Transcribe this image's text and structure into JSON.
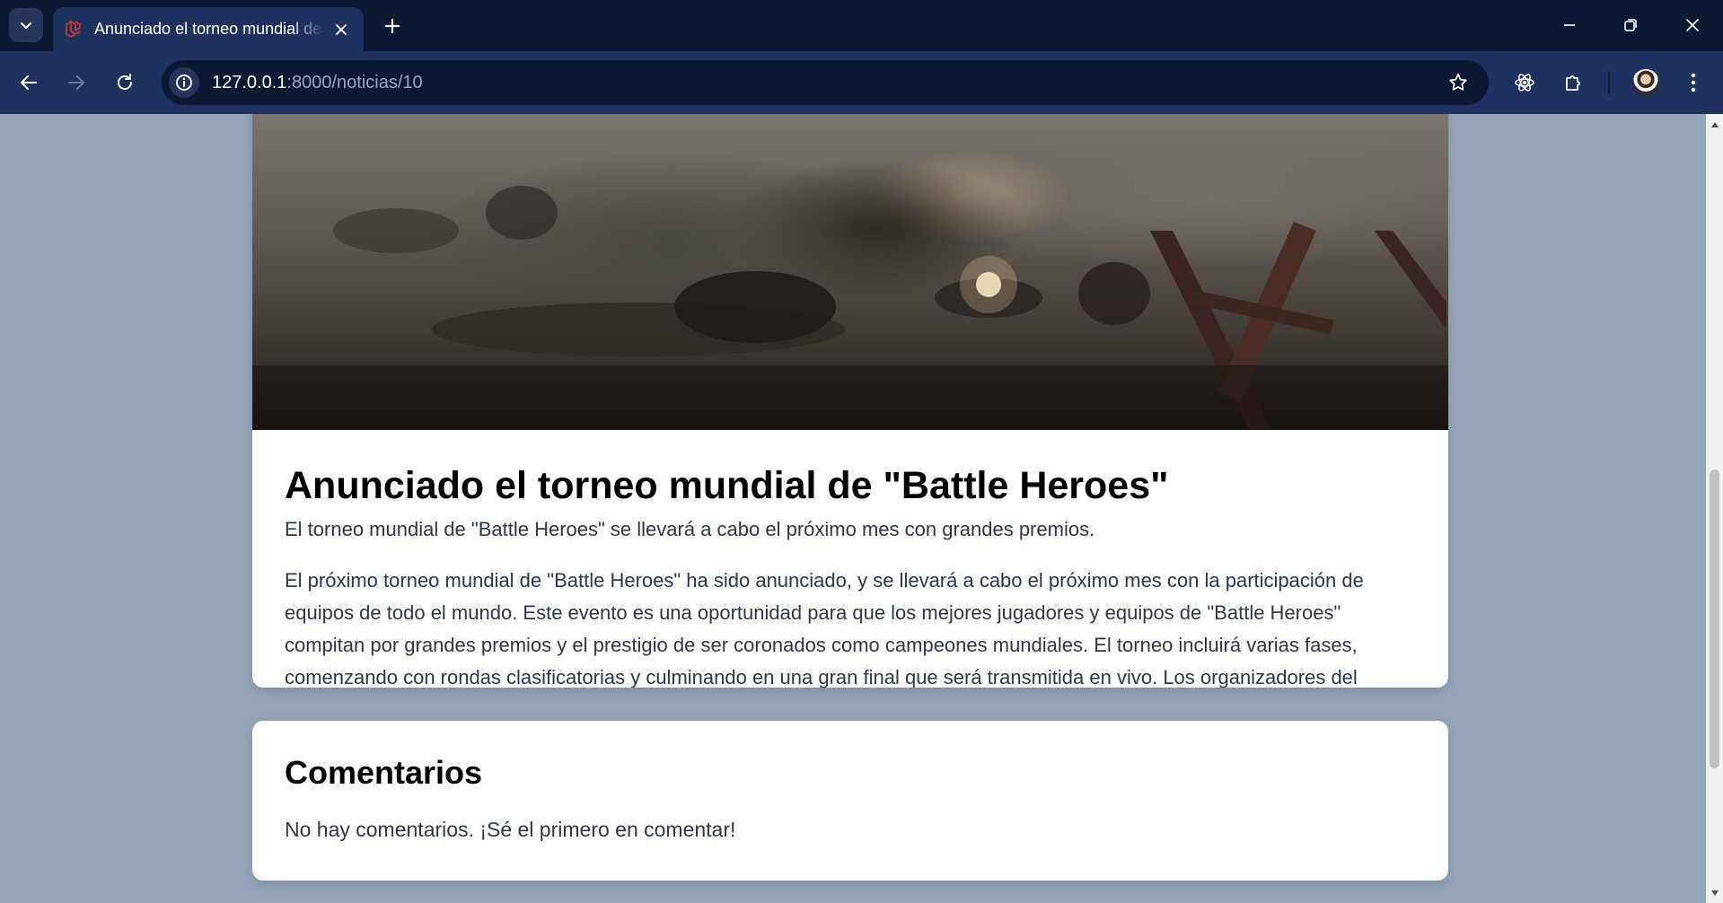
{
  "browser": {
    "tab": {
      "title": "Anunciado el torneo mundial de \"Battle Heroes\""
    },
    "url": {
      "host": "127.0.0.1",
      "path": ":8000/noticias/10"
    }
  },
  "article": {
    "title": "Anunciado el torneo mundial de \"Battle Heroes\"",
    "summary": "El torneo mundial de \"Battle Heroes\" se llevará a cabo el próximo mes con grandes premios.",
    "content": "El próximo torneo mundial de \"Battle Heroes\" ha sido anunciado, y se llevará a cabo el próximo mes con la participación de equipos de todo el mundo. Este evento es una oportunidad para que los mejores jugadores y equipos de \"Battle Heroes\" compitan por grandes premios y el prestigio de ser coronados como campeones mundiales. El torneo incluirá varias fases, comenzando con rondas clasificatorias y culminando en una gran final que será transmitida en vivo. Los organizadores del torneo han prometido una producción de alta calidad, con comentaristas profesionales y análisis detallados de cada partida."
  },
  "comments": {
    "title": "Comentarios",
    "empty_message": "No hay comentarios. ¡Sé el primero en comentar!"
  },
  "icons": {
    "tab_search": "chevron-down-icon",
    "favicon": "laravel-icon",
    "close": "close-icon",
    "new_tab": "plus-icon",
    "back": "arrow-left-icon",
    "forward": "arrow-right-icon",
    "reload": "reload-icon",
    "site_info": "info-icon",
    "bookmark": "star-icon",
    "react_devtools": "react-icon",
    "extensions": "puzzle-icon",
    "menu": "kebab-menu-icon"
  },
  "colors": {
    "tabbar_bg": "#0b1a33",
    "toolbar_bg": "#1e3260",
    "page_bg": "#94a3b8",
    "card_bg": "#ffffff",
    "favicon": "#e3342f"
  }
}
